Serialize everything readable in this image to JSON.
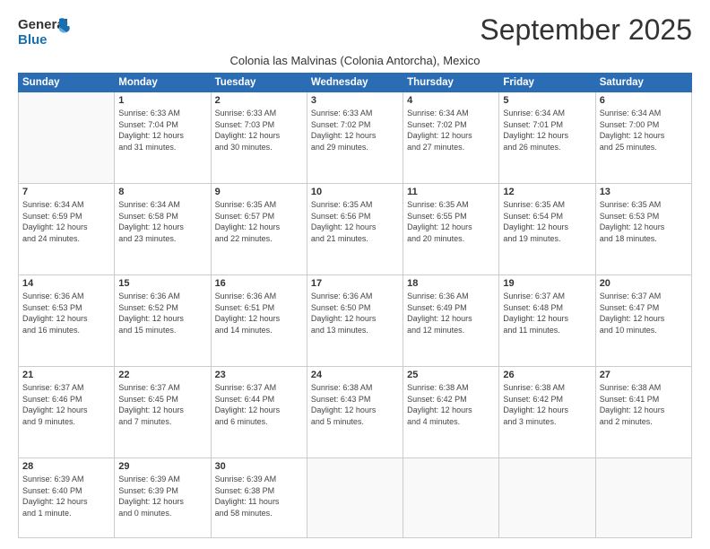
{
  "header": {
    "logo_line1": "General",
    "logo_line2": "Blue",
    "month": "September 2025",
    "location": "Colonia las Malvinas (Colonia Antorcha), Mexico"
  },
  "days_of_week": [
    "Sunday",
    "Monday",
    "Tuesday",
    "Wednesday",
    "Thursday",
    "Friday",
    "Saturday"
  ],
  "weeks": [
    [
      {
        "day": "",
        "info": ""
      },
      {
        "day": "1",
        "info": "Sunrise: 6:33 AM\nSunset: 7:04 PM\nDaylight: 12 hours\nand 31 minutes."
      },
      {
        "day": "2",
        "info": "Sunrise: 6:33 AM\nSunset: 7:03 PM\nDaylight: 12 hours\nand 30 minutes."
      },
      {
        "day": "3",
        "info": "Sunrise: 6:33 AM\nSunset: 7:02 PM\nDaylight: 12 hours\nand 29 minutes."
      },
      {
        "day": "4",
        "info": "Sunrise: 6:34 AM\nSunset: 7:02 PM\nDaylight: 12 hours\nand 27 minutes."
      },
      {
        "day": "5",
        "info": "Sunrise: 6:34 AM\nSunset: 7:01 PM\nDaylight: 12 hours\nand 26 minutes."
      },
      {
        "day": "6",
        "info": "Sunrise: 6:34 AM\nSunset: 7:00 PM\nDaylight: 12 hours\nand 25 minutes."
      }
    ],
    [
      {
        "day": "7",
        "info": "Sunrise: 6:34 AM\nSunset: 6:59 PM\nDaylight: 12 hours\nand 24 minutes."
      },
      {
        "day": "8",
        "info": "Sunrise: 6:34 AM\nSunset: 6:58 PM\nDaylight: 12 hours\nand 23 minutes."
      },
      {
        "day": "9",
        "info": "Sunrise: 6:35 AM\nSunset: 6:57 PM\nDaylight: 12 hours\nand 22 minutes."
      },
      {
        "day": "10",
        "info": "Sunrise: 6:35 AM\nSunset: 6:56 PM\nDaylight: 12 hours\nand 21 minutes."
      },
      {
        "day": "11",
        "info": "Sunrise: 6:35 AM\nSunset: 6:55 PM\nDaylight: 12 hours\nand 20 minutes."
      },
      {
        "day": "12",
        "info": "Sunrise: 6:35 AM\nSunset: 6:54 PM\nDaylight: 12 hours\nand 19 minutes."
      },
      {
        "day": "13",
        "info": "Sunrise: 6:35 AM\nSunset: 6:53 PM\nDaylight: 12 hours\nand 18 minutes."
      }
    ],
    [
      {
        "day": "14",
        "info": "Sunrise: 6:36 AM\nSunset: 6:53 PM\nDaylight: 12 hours\nand 16 minutes."
      },
      {
        "day": "15",
        "info": "Sunrise: 6:36 AM\nSunset: 6:52 PM\nDaylight: 12 hours\nand 15 minutes."
      },
      {
        "day": "16",
        "info": "Sunrise: 6:36 AM\nSunset: 6:51 PM\nDaylight: 12 hours\nand 14 minutes."
      },
      {
        "day": "17",
        "info": "Sunrise: 6:36 AM\nSunset: 6:50 PM\nDaylight: 12 hours\nand 13 minutes."
      },
      {
        "day": "18",
        "info": "Sunrise: 6:36 AM\nSunset: 6:49 PM\nDaylight: 12 hours\nand 12 minutes."
      },
      {
        "day": "19",
        "info": "Sunrise: 6:37 AM\nSunset: 6:48 PM\nDaylight: 12 hours\nand 11 minutes."
      },
      {
        "day": "20",
        "info": "Sunrise: 6:37 AM\nSunset: 6:47 PM\nDaylight: 12 hours\nand 10 minutes."
      }
    ],
    [
      {
        "day": "21",
        "info": "Sunrise: 6:37 AM\nSunset: 6:46 PM\nDaylight: 12 hours\nand 9 minutes."
      },
      {
        "day": "22",
        "info": "Sunrise: 6:37 AM\nSunset: 6:45 PM\nDaylight: 12 hours\nand 7 minutes."
      },
      {
        "day": "23",
        "info": "Sunrise: 6:37 AM\nSunset: 6:44 PM\nDaylight: 12 hours\nand 6 minutes."
      },
      {
        "day": "24",
        "info": "Sunrise: 6:38 AM\nSunset: 6:43 PM\nDaylight: 12 hours\nand 5 minutes."
      },
      {
        "day": "25",
        "info": "Sunrise: 6:38 AM\nSunset: 6:42 PM\nDaylight: 12 hours\nand 4 minutes."
      },
      {
        "day": "26",
        "info": "Sunrise: 6:38 AM\nSunset: 6:42 PM\nDaylight: 12 hours\nand 3 minutes."
      },
      {
        "day": "27",
        "info": "Sunrise: 6:38 AM\nSunset: 6:41 PM\nDaylight: 12 hours\nand 2 minutes."
      }
    ],
    [
      {
        "day": "28",
        "info": "Sunrise: 6:39 AM\nSunset: 6:40 PM\nDaylight: 12 hours\nand 1 minute."
      },
      {
        "day": "29",
        "info": "Sunrise: 6:39 AM\nSunset: 6:39 PM\nDaylight: 12 hours\nand 0 minutes."
      },
      {
        "day": "30",
        "info": "Sunrise: 6:39 AM\nSunset: 6:38 PM\nDaylight: 11 hours\nand 58 minutes."
      },
      {
        "day": "",
        "info": ""
      },
      {
        "day": "",
        "info": ""
      },
      {
        "day": "",
        "info": ""
      },
      {
        "day": "",
        "info": ""
      }
    ]
  ]
}
